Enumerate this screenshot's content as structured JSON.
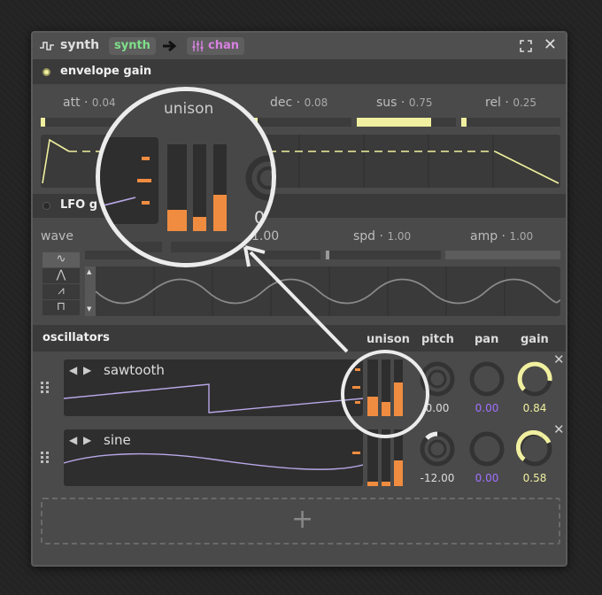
{
  "window": {
    "title": "synth",
    "chip_synth": "synth",
    "chip_chan": "chan",
    "close": "✕"
  },
  "envelope": {
    "header": "envelope gain",
    "params": [
      {
        "name": "att",
        "value": "0.04",
        "level": 0.04
      },
      {
        "name": "dec",
        "value": "0.08",
        "level": 0.08
      },
      {
        "name": "sus",
        "value": "0.75",
        "level": 0.75
      },
      {
        "name": "rel",
        "value": "0.25",
        "level": 0.04
      }
    ]
  },
  "lfo": {
    "header": "LFO g",
    "params": [
      {
        "name": "wave",
        "value": ""
      },
      {
        "name": "",
        "value": "1.00"
      },
      {
        "name": "spd",
        "value": "1.00"
      },
      {
        "name": "amp",
        "value": "1.00"
      }
    ],
    "wave_buttons": [
      "sine-wave",
      "triangle-wave",
      "sawtooth-wave",
      "square-wave"
    ]
  },
  "oscillators": {
    "header": "oscillators",
    "columns": {
      "unison": "unison",
      "pitch": "pitch",
      "pan": "pan",
      "gain": "gain"
    },
    "rows": [
      {
        "name": "sawtooth",
        "pitch": "0.00",
        "pan": "0.00",
        "gain": "0.84",
        "unison_levels": [
          0.35,
          0.25,
          0.6
        ],
        "gain_level": 0.84,
        "pitch_level": 0.5
      },
      {
        "name": "sine",
        "pitch": "-12.00",
        "pan": "0.00",
        "gain": "0.58",
        "unison_levels": [
          0.1,
          0.1,
          0.55
        ],
        "gain_level": 0.58,
        "pitch_level": 0.2
      }
    ],
    "add_label": "+"
  },
  "magnifier": {
    "title": "unison",
    "partial_value": "0"
  },
  "colors": {
    "accent_yellow": "#f0f0a0",
    "accent_orange": "#f08c40",
    "accent_green": "#7ee08a",
    "accent_purple": "#c070e0",
    "value_purple": "#a070ff",
    "wave_lilac": "#b8a8e8"
  }
}
